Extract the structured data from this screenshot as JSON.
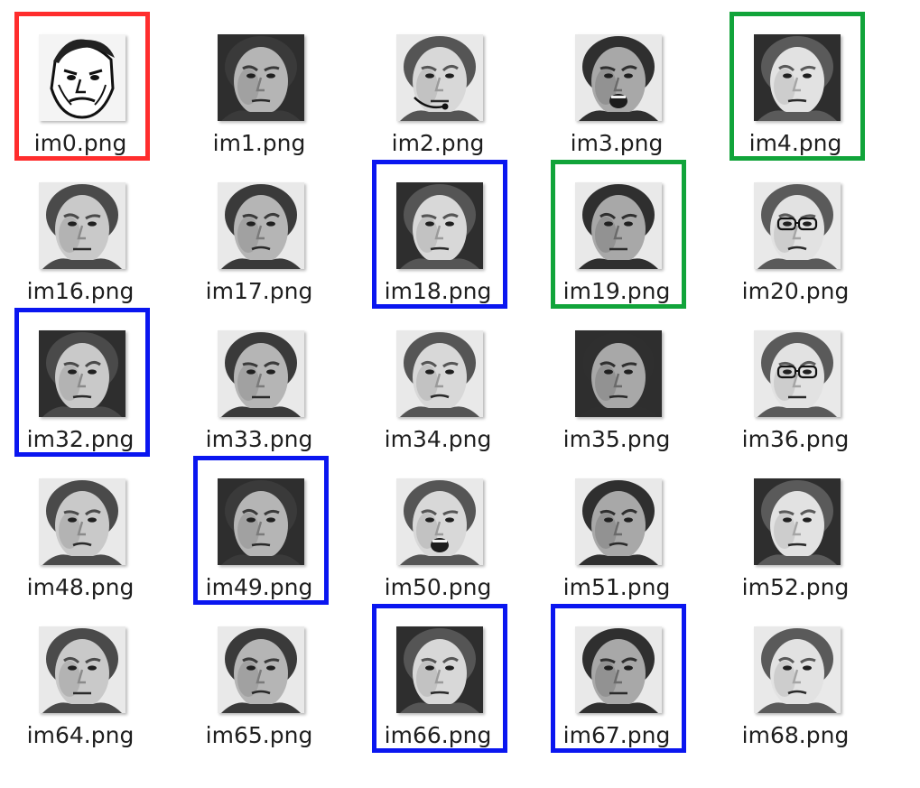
{
  "colors": {
    "red": "#ff2d2d",
    "blue": "#0a16f0",
    "green": "#11a43a"
  },
  "files": [
    {
      "name": "im0.png",
      "highlight": "red",
      "icon": "face-sketch-icon"
    },
    {
      "name": "im1.png",
      "highlight": null,
      "icon": "face-icon"
    },
    {
      "name": "im2.png",
      "highlight": null,
      "icon": "face-headset-icon"
    },
    {
      "name": "im3.png",
      "highlight": null,
      "icon": "face-icon"
    },
    {
      "name": "im4.png",
      "highlight": "green",
      "icon": "face-icon"
    },
    {
      "name": "im16.png",
      "highlight": null,
      "icon": "face-icon"
    },
    {
      "name": "im17.png",
      "highlight": null,
      "icon": "face-icon"
    },
    {
      "name": "im18.png",
      "highlight": "blue",
      "icon": "face-icon"
    },
    {
      "name": "im19.png",
      "highlight": "green",
      "icon": "face-icon"
    },
    {
      "name": "im20.png",
      "highlight": null,
      "icon": "face-glasses-icon"
    },
    {
      "name": "im32.png",
      "highlight": "blue",
      "icon": "face-icon"
    },
    {
      "name": "im33.png",
      "highlight": null,
      "icon": "face-icon"
    },
    {
      "name": "im34.png",
      "highlight": null,
      "icon": "face-icon"
    },
    {
      "name": "im35.png",
      "highlight": null,
      "icon": "face-icon"
    },
    {
      "name": "im36.png",
      "highlight": null,
      "icon": "face-glasses-icon"
    },
    {
      "name": "im48.png",
      "highlight": null,
      "icon": "face-icon"
    },
    {
      "name": "im49.png",
      "highlight": "blue",
      "icon": "face-icon"
    },
    {
      "name": "im50.png",
      "highlight": null,
      "icon": "face-icon"
    },
    {
      "name": "im51.png",
      "highlight": null,
      "icon": "face-icon"
    },
    {
      "name": "im52.png",
      "highlight": null,
      "icon": "face-icon"
    },
    {
      "name": "im64.png",
      "highlight": null,
      "icon": "face-icon"
    },
    {
      "name": "im65.png",
      "highlight": null,
      "icon": "face-icon"
    },
    {
      "name": "im66.png",
      "highlight": "blue",
      "icon": "face-icon"
    },
    {
      "name": "im67.png",
      "highlight": "blue",
      "icon": "face-icon"
    },
    {
      "name": "im68.png",
      "highlight": null,
      "icon": "face-icon"
    }
  ]
}
